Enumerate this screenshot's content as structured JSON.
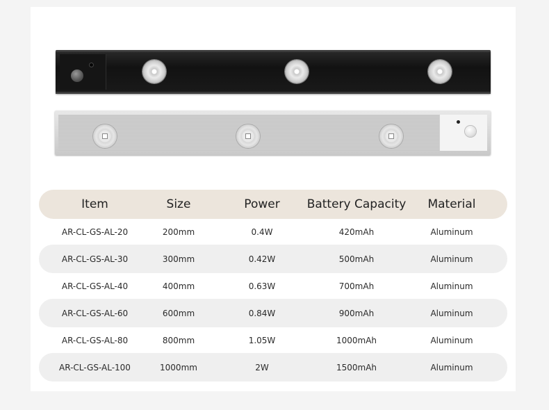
{
  "images": {
    "top_product": "black-aluminum-cabinet-light",
    "bottom_product": "silver-aluminum-cabinet-light"
  },
  "table": {
    "headers": [
      "Item",
      "Size",
      "Power",
      "Battery Capacity",
      "Material"
    ],
    "rows": [
      [
        "AR-CL-GS-AL-20",
        "200mm",
        "0.4W",
        "420mAh",
        "Aluminum"
      ],
      [
        "AR-CL-GS-AL-30",
        "300mm",
        "0.42W",
        "500mAh",
        "Aluminum"
      ],
      [
        "AR-CL-GS-AL-40",
        "400mm",
        "0.63W",
        "700mAh",
        "Aluminum"
      ],
      [
        "AR-CL-GS-AL-60",
        "600mm",
        "0.84W",
        "900mAh",
        "Aluminum"
      ],
      [
        "AR-CL-GS-AL-80",
        "800mm",
        "1.05W",
        "1000mAh",
        "Aluminum"
      ],
      [
        "AR-CL-GS-AL-100",
        "1000mm",
        "2W",
        "1500mAh",
        "Aluminum"
      ]
    ]
  },
  "colors": {
    "header_bg": "#ece5dc",
    "shaded_row_bg": "#efefef",
    "bar_black": "#151515",
    "bar_silver": "#cccccc"
  }
}
